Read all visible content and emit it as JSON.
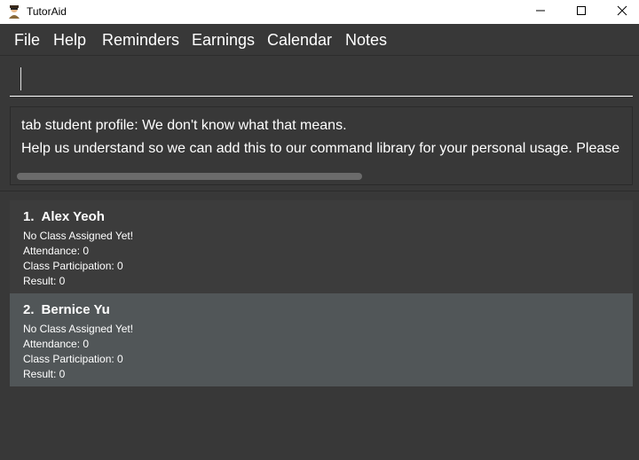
{
  "window": {
    "title": "TutorAid"
  },
  "menu": {
    "items": [
      "File",
      "Help",
      "Reminders",
      "Earnings",
      "Calendar",
      "Notes"
    ]
  },
  "command_box": {
    "value": ""
  },
  "result": {
    "line1": "tab student profile: We don't know what that means.",
    "line2": "Help us understand so we can add this to our command library for your personal usage. Please"
  },
  "students": [
    {
      "index": "1.",
      "name": "Alex Yeoh",
      "class_status": "No Class Assigned Yet!",
      "attendance": "Attendance: 0",
      "participation": "Class Participation: 0",
      "result": "Result: 0"
    },
    {
      "index": "2.",
      "name": "Bernice Yu",
      "class_status": "No Class Assigned Yet!",
      "attendance": "Attendance: 0",
      "participation": "Class Participation: 0",
      "result": "Result: 0"
    }
  ],
  "colors": {
    "background": "#383838",
    "selected_card": "#515658",
    "text": "#ffffff"
  },
  "icons": [
    "app-logo-icon",
    "minimize-icon",
    "maximize-icon",
    "close-icon"
  ]
}
